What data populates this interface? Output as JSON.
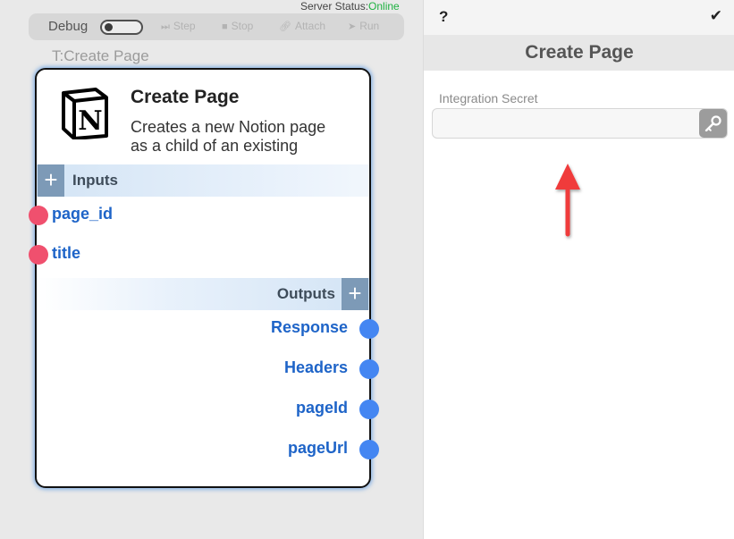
{
  "server_status": {
    "label": "Server Status:",
    "value": "Online",
    "value_color": "#1fb141"
  },
  "debug_bar": {
    "debug_label": "Debug",
    "debug_enabled": false,
    "buttons": [
      {
        "label": "Step",
        "icon": "step-icon"
      },
      {
        "label": "Stop",
        "icon": "stop-icon"
      },
      {
        "label": "Attach",
        "icon": "attach-icon"
      },
      {
        "label": "Run",
        "icon": "run-icon"
      }
    ]
  },
  "node": {
    "canvas_label": "T:Create Page",
    "title": "Create Page",
    "description": "Creates a new Notion page as a child of an existing",
    "logo_letter": "N",
    "inputs_label": "Inputs",
    "outputs_label": "Outputs",
    "inputs": [
      "page_id",
      "title"
    ],
    "outputs": [
      "Response",
      "Headers",
      "pageId",
      "pageUrl"
    ],
    "input_port_color": "#f0506e",
    "output_port_color": "#4486f2"
  },
  "panel": {
    "help": "?",
    "confirm_icon": "checkmark-icon",
    "title": "Create Page",
    "field_label": "Integration Secret",
    "field_value": "",
    "field_button_icon": "key-icon"
  },
  "annotation": {
    "arrow_color": "#f03a3a"
  }
}
